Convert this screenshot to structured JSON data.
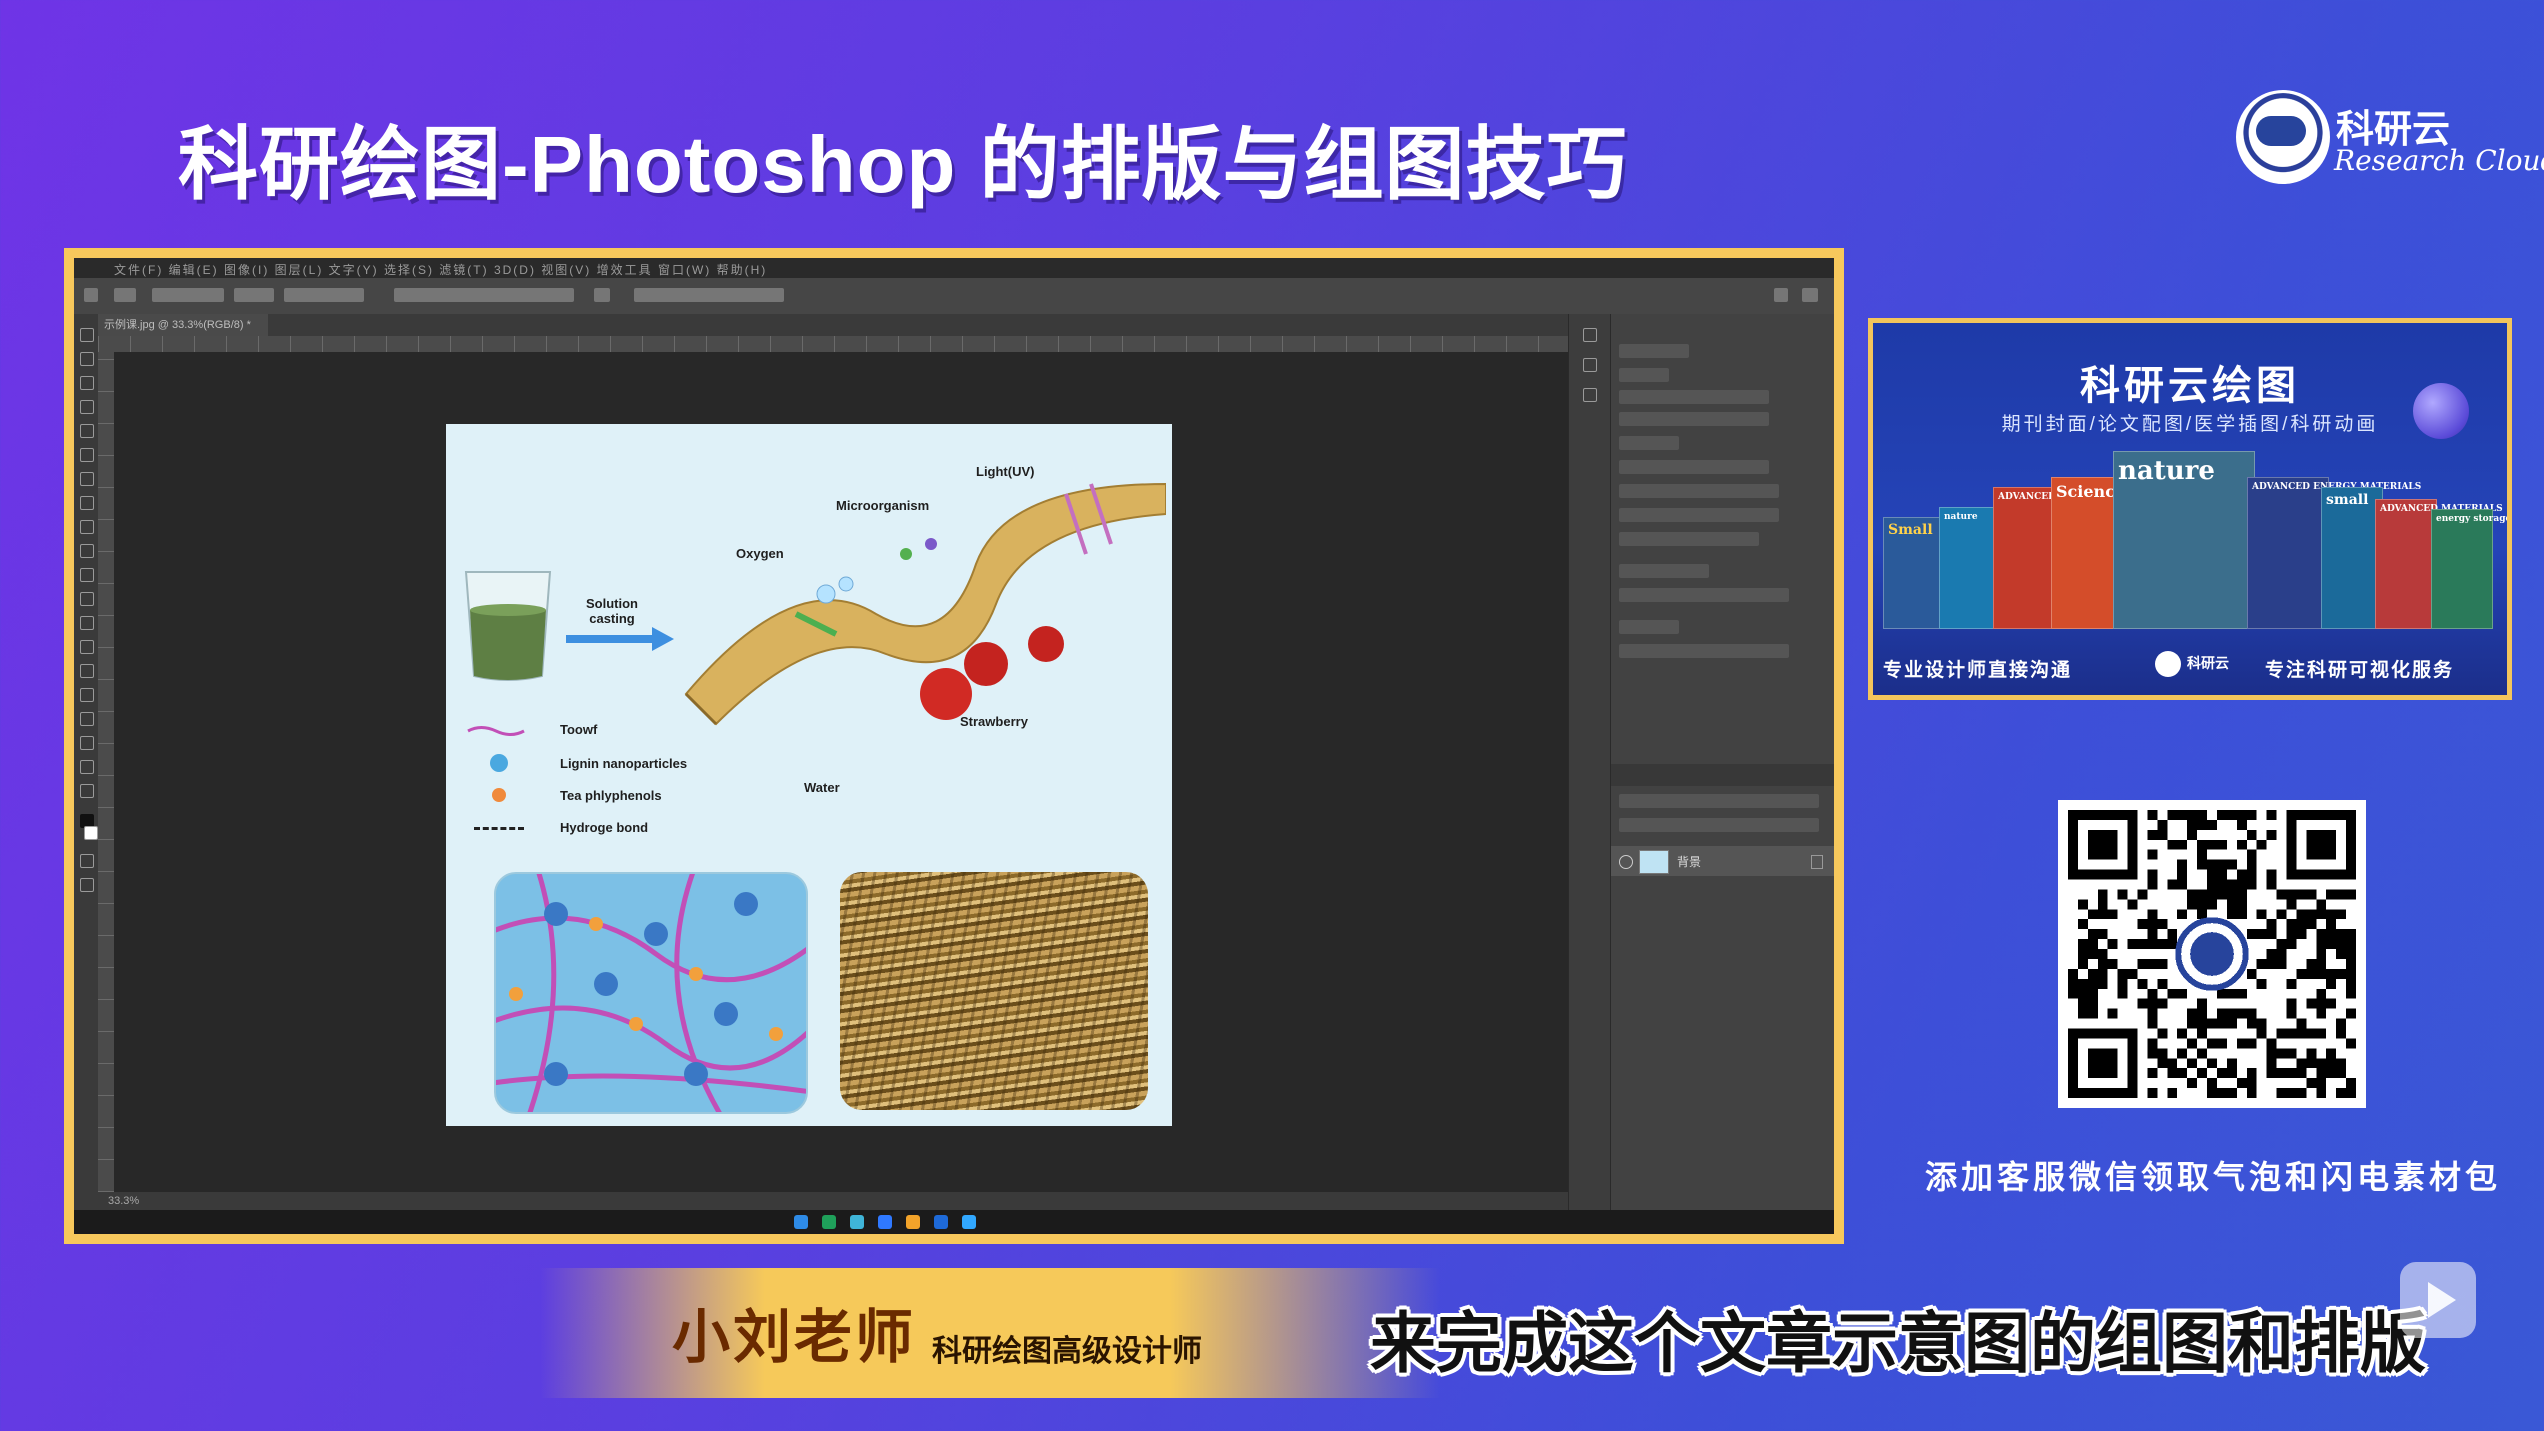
{
  "title": "科研绘图-Photoshop 的排版与组图技巧",
  "logo": {
    "cn": "科研云",
    "en": "Research Cloud"
  },
  "photoshop": {
    "menu": "文件(F)  编辑(E)  图像(I)  图层(L)  文字(Y)  选择(S)  滤镜(T)  3D(D)  视图(V)  增效工具  窗口(W)  帮助(H)",
    "doc_tab": "示例课.jpg @ 33.3%(RGB/8) *",
    "zoom": "33.3%",
    "layer_name": "背景"
  },
  "figure": {
    "labels": {
      "light": "Light(UV)",
      "microorganism": "Microorganism",
      "oxygen": "Oxygen",
      "solution_casting": "Solution\ncasting",
      "strawberry": "Strawberry",
      "water": "Water"
    },
    "legend": [
      {
        "label": "Toowf",
        "symbol": "wave",
        "color": "#c24fb7"
      },
      {
        "label": "Lignin nanoparticles",
        "symbol": "circle",
        "color": "#4aa8e0"
      },
      {
        "label": "Tea phlyphenols",
        "symbol": "circle",
        "color": "#f08a3c"
      },
      {
        "label": "Hydroge bond",
        "symbol": "dashed",
        "color": "#222222"
      }
    ]
  },
  "promo": {
    "title": "科研云绘图",
    "subtitle": "期刊封面/论文配图/医学插图/科研动画",
    "left": "专业设计师直接沟通",
    "right": "专注科研可视化服务",
    "covers": [
      "Small",
      "nature",
      "ADVANCED MATERIALS",
      "Science",
      "nature",
      "ADVANCED ENERGY MATERIALS",
      "small",
      "ADVANCED MATERIALS",
      "energy storage materials"
    ]
  },
  "qr_caption": "添加客服微信领取气泡和闪电素材包",
  "presenter": {
    "name": "小刘老师",
    "role": "科研绘图高级设计师"
  },
  "subtitle": "来完成这个文章示意图的组图和排版",
  "colors": {
    "frame": "#f7c85c",
    "accent": "#f6c95a",
    "background": "#5a3fe0"
  }
}
